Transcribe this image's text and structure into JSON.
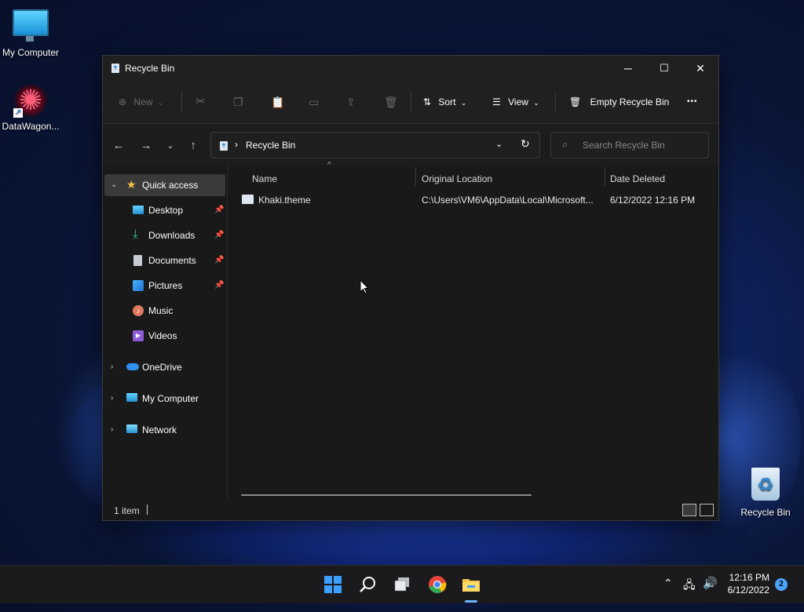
{
  "desktop": {
    "icons": [
      {
        "label": "My Computer"
      },
      {
        "label": "DataWagon..."
      },
      {
        "label": "Recycle Bin"
      }
    ]
  },
  "window": {
    "title": "Recycle Bin",
    "controls": {
      "minimize": "─",
      "maximize": "☐",
      "close": "✕"
    }
  },
  "toolbar": {
    "new_label": "New",
    "sort_label": "Sort",
    "view_label": "View",
    "empty_label": "Empty Recycle Bin",
    "more_label": "•••"
  },
  "navigation": {
    "address_path": "Recycle Bin",
    "search_placeholder": "Search Recycle Bin"
  },
  "sidebar": {
    "items": [
      {
        "label": "Quick access",
        "icon": "star-icon"
      },
      {
        "label": "Desktop",
        "icon": "desktop-icon"
      },
      {
        "label": "Downloads",
        "icon": "download-icon"
      },
      {
        "label": "Documents",
        "icon": "document-icon"
      },
      {
        "label": "Pictures",
        "icon": "picture-icon"
      },
      {
        "label": "Music",
        "icon": "music-icon"
      },
      {
        "label": "Videos",
        "icon": "video-icon"
      },
      {
        "label": "OneDrive",
        "icon": "cloud-icon"
      },
      {
        "label": "My Computer",
        "icon": "monitor-icon"
      },
      {
        "label": "Network",
        "icon": "network-icon"
      }
    ]
  },
  "content": {
    "columns": [
      "Name",
      "Original Location",
      "Date Deleted"
    ],
    "rows": [
      {
        "name": "Khaki.theme",
        "location": "C:\\Users\\VM6\\AppData\\Local\\Microsoft...",
        "date": "6/12/2022 12:16 PM"
      }
    ]
  },
  "statusbar": {
    "count": "1 item"
  },
  "taskbar": {
    "time": "12:16 PM",
    "date": "6/12/2022",
    "notification_count": "2"
  },
  "colors": {
    "accent": "#4ba3ff",
    "folder": "#f2c94c"
  }
}
